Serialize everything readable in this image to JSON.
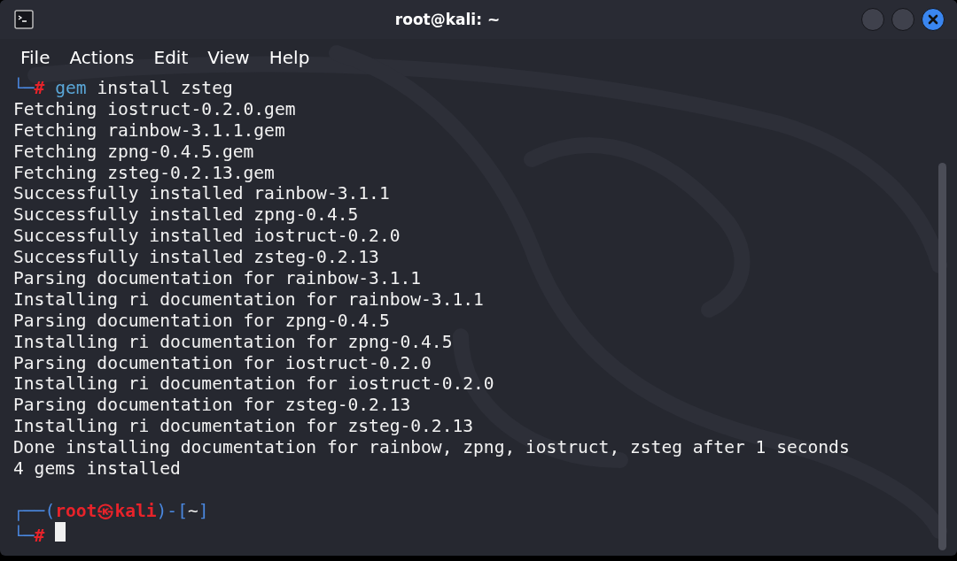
{
  "window": {
    "title": "root@kali: ~"
  },
  "menu": [
    "File",
    "Actions",
    "Edit",
    "View",
    "Help"
  ],
  "command_prompt": {
    "corner": "└─",
    "hash": "#",
    "program": "gem",
    "args": "install zsteg"
  },
  "output": [
    "Fetching iostruct-0.2.0.gem",
    "Fetching rainbow-3.1.1.gem",
    "Fetching zpng-0.4.5.gem",
    "Fetching zsteg-0.2.13.gem",
    "Successfully installed rainbow-3.1.1",
    "Successfully installed zpng-0.4.5",
    "Successfully installed iostruct-0.2.0",
    "Successfully installed zsteg-0.2.13",
    "Parsing documentation for rainbow-3.1.1",
    "Installing ri documentation for rainbow-3.1.1",
    "Parsing documentation for zpng-0.4.5",
    "Installing ri documentation for zpng-0.4.5",
    "Parsing documentation for iostruct-0.2.0",
    "Installing ri documentation for iostruct-0.2.0",
    "Parsing documentation for zsteg-0.2.13",
    "Installing ri documentation for zsteg-0.2.13",
    "Done installing documentation for rainbow, zpng, iostruct, zsteg after 1 seconds",
    "4 gems installed"
  ],
  "prompt": {
    "corner_top": "┌──(",
    "user": "root",
    "at": "㉿",
    "host": "kali",
    "middle": ")-[",
    "dir": "~",
    "end": "]",
    "corner_bottom": "└─",
    "hash": "#"
  }
}
